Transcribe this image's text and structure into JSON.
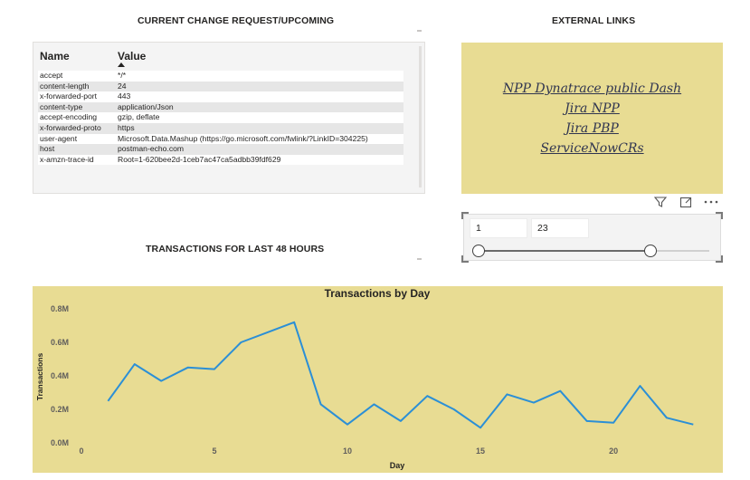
{
  "headings": {
    "change_request": "CURRENT CHANGE REQUEST/UPCOMING",
    "external_links": "EXTERNAL LINKS",
    "transactions": "TRANSACTIONS FOR LAST 48 HOURS"
  },
  "table": {
    "columns": [
      "Name",
      "Value"
    ],
    "rows": [
      {
        "name": "accept",
        "value": "*/*"
      },
      {
        "name": "content-length",
        "value": "24"
      },
      {
        "name": "x-forwarded-port",
        "value": "443"
      },
      {
        "name": "content-type",
        "value": "application/Json"
      },
      {
        "name": "accept-encoding",
        "value": "gzip, deflate"
      },
      {
        "name": "x-forwarded-proto",
        "value": "https"
      },
      {
        "name": "user-agent",
        "value": "Microsoft.Data.Mashup (https://go.microsoft.com/fwlink/?LinkID=304225)"
      },
      {
        "name": "host",
        "value": "postman-echo.com"
      },
      {
        "name": "x-amzn-trace-id",
        "value": "Root=1-620bee2d-1ceb7ac47ca5adbb39fdf629"
      }
    ]
  },
  "links": [
    {
      "label": "NPP Dynatrace public Dash"
    },
    {
      "label": "Jira NPP"
    },
    {
      "label": "Jira PBP"
    },
    {
      "label": "ServiceNowCRs"
    }
  ],
  "visual_icons": [
    "filter-icon",
    "focus-mode-icon",
    "more-options-icon"
  ],
  "slicer": {
    "min_value": "1",
    "max_value": "23",
    "range_min": 1,
    "range_max": 23,
    "selected_low": 1,
    "selected_high": 23
  },
  "colors": {
    "card_bg": "#e8dc93",
    "line": "#2b8fd6",
    "link": "#303550"
  },
  "chart_data": {
    "type": "line",
    "title": "Transactions by Day",
    "xlabel": "Day",
    "ylabel": "Transactions",
    "xlim": [
      0,
      23.5
    ],
    "ylim": [
      0,
      0.8
    ],
    "x_ticks": [
      0,
      5,
      10,
      15,
      20
    ],
    "y_ticks": [
      0,
      0.2,
      0.4,
      0.6,
      0.8
    ],
    "y_tick_labels": [
      "0.0M",
      "0.2M",
      "0.4M",
      "0.6M",
      "0.8M"
    ],
    "grid": false,
    "series": [
      {
        "x": [
          1,
          2,
          3,
          4,
          5,
          6,
          7,
          8,
          9,
          10,
          11,
          12,
          13,
          14,
          15,
          16,
          17,
          18,
          19,
          20,
          21,
          22,
          23
        ],
        "y": [
          0.25,
          0.47,
          0.37,
          0.45,
          0.44,
          0.6,
          0.66,
          0.72,
          0.23,
          0.11,
          0.23,
          0.13,
          0.28,
          0.2,
          0.09,
          0.29,
          0.24,
          0.31,
          0.13,
          0.12,
          0.34,
          0.15,
          0.11
        ]
      }
    ]
  }
}
